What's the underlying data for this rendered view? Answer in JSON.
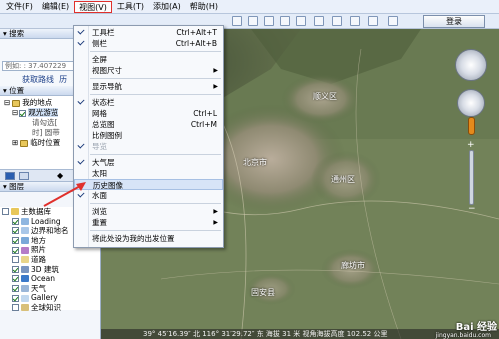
{
  "menubar": {
    "items": [
      "文件(F)",
      "编辑(E)",
      "视图(V)",
      "工具(T)",
      "添加(A)",
      "帮助(H)"
    ],
    "active_index": 2
  },
  "toolbar": {
    "login_label": "登录"
  },
  "search_panel": {
    "title": "搜索",
    "coord_value": "例如: : 37.407229",
    "route_label": "获取路线",
    "route_more": "历"
  },
  "positions_panel": {
    "title": "位置",
    "rows": [
      "我的地点",
      "观光游览",
      "请勾选[",
      "时] 圆带",
      "临时位置"
    ]
  },
  "layers_panel": {
    "title": "图层",
    "rows": [
      {
        "label": "主数据库",
        "checked": false
      },
      {
        "label": "Loading",
        "checked": true
      },
      {
        "label": "边界和地名",
        "checked": true
      },
      {
        "label": "地方",
        "checked": true
      },
      {
        "label": "照片",
        "checked": true
      },
      {
        "label": "道路",
        "checked": false
      },
      {
        "label": "3D 建筑",
        "checked": true
      },
      {
        "label": "Ocean",
        "checked": true
      },
      {
        "label": "天气",
        "checked": true
      },
      {
        "label": "Gallery",
        "checked": true
      },
      {
        "label": "全球知识",
        "checked": false
      }
    ]
  },
  "view_menu": {
    "items": [
      {
        "label": "工具栏",
        "shortcut": "Ctrl+Alt+T",
        "checked": true
      },
      {
        "label": "侧栏",
        "shortcut": "Ctrl+Alt+B",
        "checked": true
      },
      {
        "sep": true
      },
      {
        "label": "全屏",
        "shortcut": ""
      },
      {
        "label": "视图尺寸",
        "submenu": true
      },
      {
        "sep": true
      },
      {
        "label": "显示导航",
        "submenu": true
      },
      {
        "sep": true
      },
      {
        "label": "状态栏",
        "checked": true
      },
      {
        "label": "网格",
        "shortcut": "Ctrl+L"
      },
      {
        "label": "总览图",
        "shortcut": "Ctrl+M"
      },
      {
        "label": "比例图例"
      },
      {
        "label": "导览",
        "disabled": true,
        "checked": true
      },
      {
        "sep": true
      },
      {
        "label": "大气层",
        "checked": true
      },
      {
        "label": "太阳"
      },
      {
        "label": "历史图像",
        "highlighted": true
      },
      {
        "label": "水面",
        "checked": true
      },
      {
        "sep": true
      },
      {
        "label": "浏览",
        "submenu": true
      },
      {
        "label": "重置",
        "submenu": true
      },
      {
        "sep": true
      },
      {
        "label": "将此处设为我的出发位置"
      }
    ]
  },
  "map": {
    "labels": [
      "顺义区",
      "北京市",
      "通州区",
      "固安县",
      "廊坊市"
    ],
    "status_text": "39° 45′16.39″ 北 116° 31′29.72″ 东 海拔   31 米  视角海拔高度 102.52 公里"
  },
  "watermark": {
    "text": "Bai 经验",
    "sub": "jingyan.baidu.com"
  },
  "colors": {
    "menu_highlight": "#d7e4f7",
    "active_menu_border": "#e0302c",
    "arrow": "#e0302c"
  }
}
